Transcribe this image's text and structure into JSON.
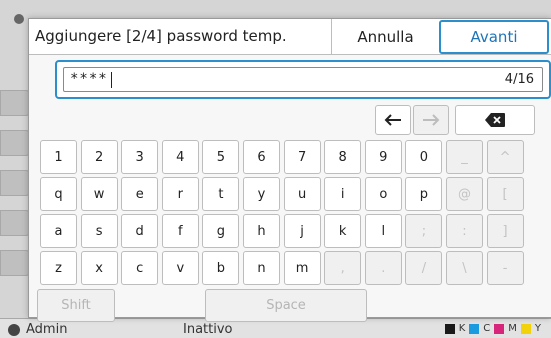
{
  "background": {
    "user": "Admin",
    "status": "Inattivo",
    "ink_labels": [
      "K",
      "C",
      "M",
      "Y"
    ],
    "ink_colors": [
      "#1a1a1a",
      "#1a9be0",
      "#d6257a",
      "#f1d20b"
    ]
  },
  "dialog": {
    "title": "Aggiungere [2/4] password temp.",
    "cancel_label": "Annulla",
    "next_label": "Avanti",
    "accent_color": "#2b8fce"
  },
  "input": {
    "value": "****",
    "counter": "4/16"
  },
  "keyboard": {
    "row1": [
      "1",
      "2",
      "3",
      "4",
      "5",
      "6",
      "7",
      "8",
      "9",
      "0",
      "_",
      "^"
    ],
    "row2": [
      "q",
      "w",
      "e",
      "r",
      "t",
      "y",
      "u",
      "i",
      "o",
      "p",
      "@",
      "["
    ],
    "row3": [
      "a",
      "s",
      "d",
      "f",
      "g",
      "h",
      "j",
      "k",
      "l",
      ";",
      ":",
      "]"
    ],
    "row4": [
      "z",
      "x",
      "c",
      "v",
      "b",
      "n",
      "m",
      ",",
      ".",
      "/",
      "\\",
      "-"
    ],
    "disabled_keys": [
      "_",
      "^",
      "@",
      "[",
      ";",
      ":",
      "]",
      ",",
      ".",
      "/",
      "\\",
      "-"
    ],
    "shift_label": "Shift",
    "space_label": "Space",
    "left_arrow_icon": "arrow-left-icon",
    "right_arrow_icon": "arrow-right-icon",
    "backspace_icon": "backspace-icon"
  }
}
